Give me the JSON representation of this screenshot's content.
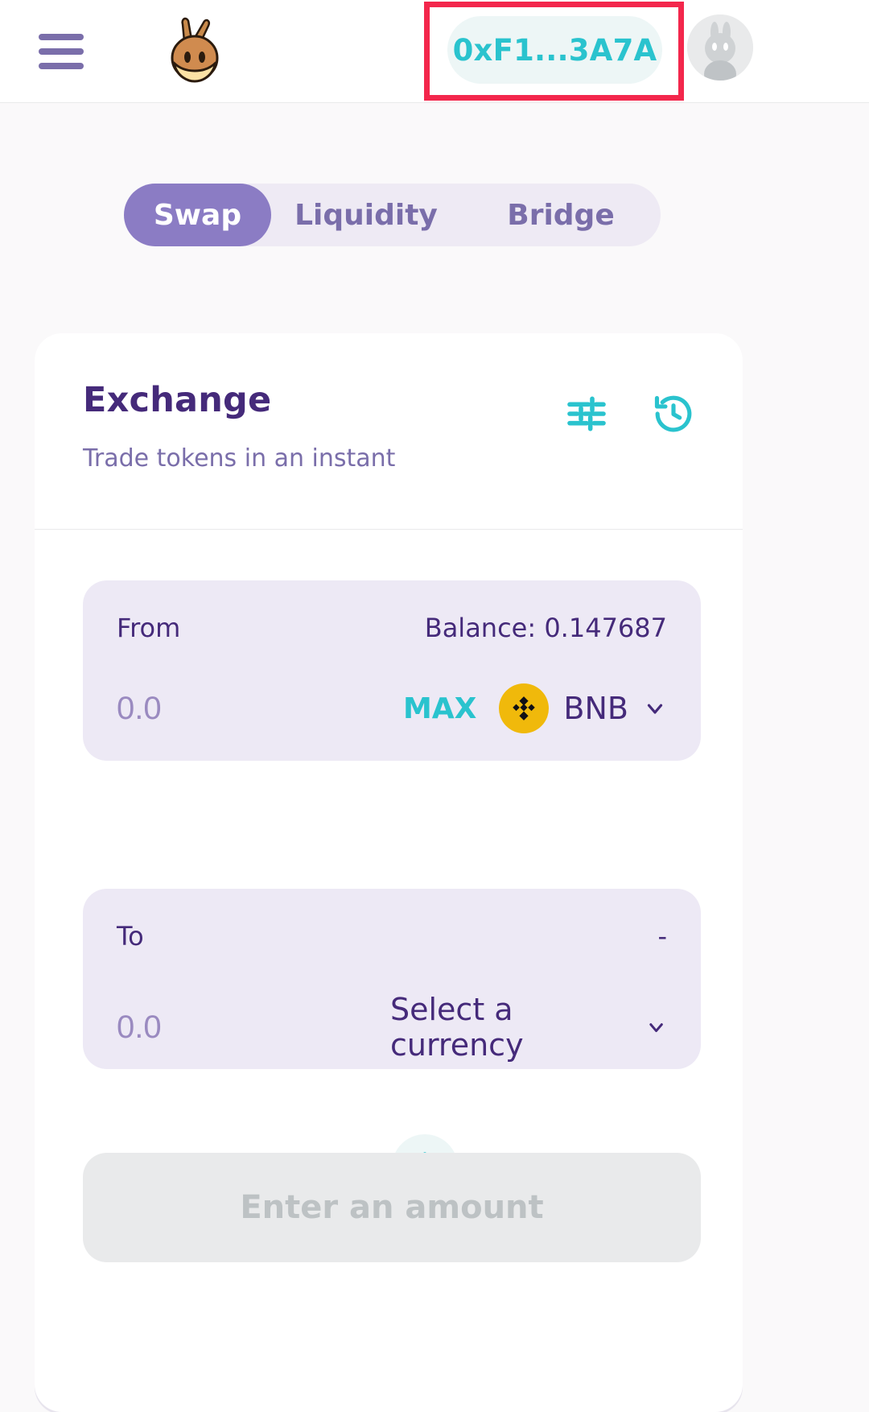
{
  "header": {
    "menu_icon": "hamburger-menu-icon",
    "logo_icon": "pancakeswap-bunny-logo",
    "wallet_label": "0xF1...3A7A",
    "avatar_icon": "user-avatar-bunny-icon",
    "annotation_color": "#F3274C"
  },
  "tabs": [
    {
      "label": "Swap",
      "active": true
    },
    {
      "label": "Liquidity",
      "active": false
    },
    {
      "label": "Bridge",
      "active": false
    }
  ],
  "exchange": {
    "title": "Exchange",
    "subtitle": "Trade tokens in an instant",
    "settings_icon": "settings-sliders-icon",
    "history_icon": "transaction-history-clock-icon"
  },
  "from": {
    "label": "From",
    "balance": "Balance: 0.147687",
    "amount": "",
    "amount_placeholder": "0.0",
    "max_label": "MAX",
    "token": "BNB",
    "token_logo": "binance-coin-icon",
    "chevron_icon": "chevron-down-icon"
  },
  "swap_arrow": {
    "icon": "arrow-down-icon"
  },
  "to": {
    "label": "To",
    "balance": "-",
    "amount": "",
    "amount_placeholder": "0.0",
    "token": "Select a currency",
    "chevron_icon": "chevron-down-icon"
  },
  "action": {
    "label": "Enter an amount",
    "disabled": true
  },
  "colors": {
    "primary": "#452A7A",
    "secondary": "#7A6EAA",
    "accent_teal": "#2AC3CE",
    "tab_active": "#8B7CC4",
    "panel_bg": "#EDE9F5",
    "bnb_yellow": "#F0B90B",
    "annotation_red": "#F3274C"
  }
}
